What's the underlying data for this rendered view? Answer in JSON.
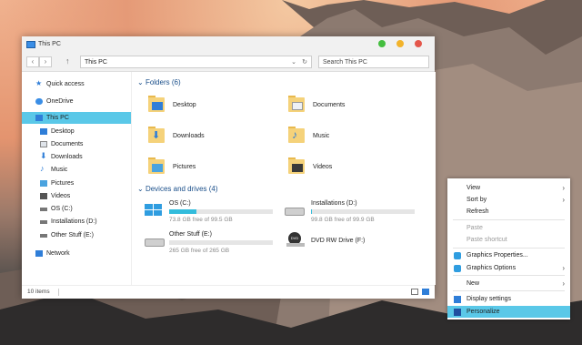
{
  "window": {
    "title": "This PC",
    "address": "This PC",
    "search_placeholder": "Search This PC",
    "back_icon": "chevron-left-icon",
    "forward_icon": "chevron-right-icon",
    "up_icon": "arrow-up-icon",
    "close_color": "#e4564a",
    "max_color": "#f2b32b",
    "min_color": "#44be3f"
  },
  "sidebar": {
    "items": [
      {
        "label": "Quick access",
        "icon": "star-icon"
      },
      {
        "label": "OneDrive",
        "icon": "cloud-icon"
      },
      {
        "label": "This PC",
        "icon": "computer-icon"
      },
      {
        "label": "Desktop",
        "icon": "desktop-icon"
      },
      {
        "label": "Documents",
        "icon": "documents-icon"
      },
      {
        "label": "Downloads",
        "icon": "download-icon"
      },
      {
        "label": "Music",
        "icon": "music-icon"
      },
      {
        "label": "Pictures",
        "icon": "pictures-icon"
      },
      {
        "label": "Videos",
        "icon": "videos-icon"
      },
      {
        "label": "OS (C:)",
        "icon": "drive-icon"
      },
      {
        "label": "Installations (D:)",
        "icon": "drive-icon"
      },
      {
        "label": "Other Stuff (E:)",
        "icon": "drive-icon"
      },
      {
        "label": "Network",
        "icon": "network-icon"
      }
    ],
    "selected": "This PC"
  },
  "content": {
    "folders_header": "Folders (6)",
    "drives_header": "Devices and drives (4)",
    "folders": [
      {
        "name": "Desktop"
      },
      {
        "name": "Documents"
      },
      {
        "name": "Downloads"
      },
      {
        "name": "Music"
      },
      {
        "name": "Pictures"
      },
      {
        "name": "Videos"
      }
    ],
    "drives": [
      {
        "name": "OS (C:)",
        "free": "73.8 GB free of 99.5 GB",
        "used_fraction": 0.26
      },
      {
        "name": "Installations (D:)",
        "free": "99.8 GB free of 99.9 GB",
        "used_fraction": 0.01
      },
      {
        "name": "Other Stuff (E:)",
        "free": "265 GB free of 265 GB",
        "used_fraction": 0.0
      },
      {
        "name": "DVD RW Drive (F:)",
        "free": ""
      }
    ]
  },
  "status": {
    "items": "10 items"
  },
  "context_menu": {
    "items": [
      {
        "label": "View",
        "submenu": true,
        "disabled": false
      },
      {
        "label": "Sort by",
        "submenu": true,
        "disabled": false
      },
      {
        "label": "Refresh",
        "submenu": false,
        "disabled": false
      },
      {
        "label": "Paste",
        "submenu": false,
        "disabled": true
      },
      {
        "label": "Paste shortcut",
        "submenu": false,
        "disabled": true
      },
      {
        "label": "Graphics Properties...",
        "submenu": false,
        "disabled": false,
        "icon": "graphics-icon"
      },
      {
        "label": "Graphics Options",
        "submenu": true,
        "disabled": false,
        "icon": "graphics-icon"
      },
      {
        "label": "New",
        "submenu": true,
        "disabled": false
      },
      {
        "label": "Display settings",
        "submenu": false,
        "disabled": false,
        "icon": "display-icon"
      },
      {
        "label": "Personalize",
        "submenu": false,
        "disabled": false,
        "icon": "personalize-icon",
        "highlighted": true
      }
    ]
  }
}
